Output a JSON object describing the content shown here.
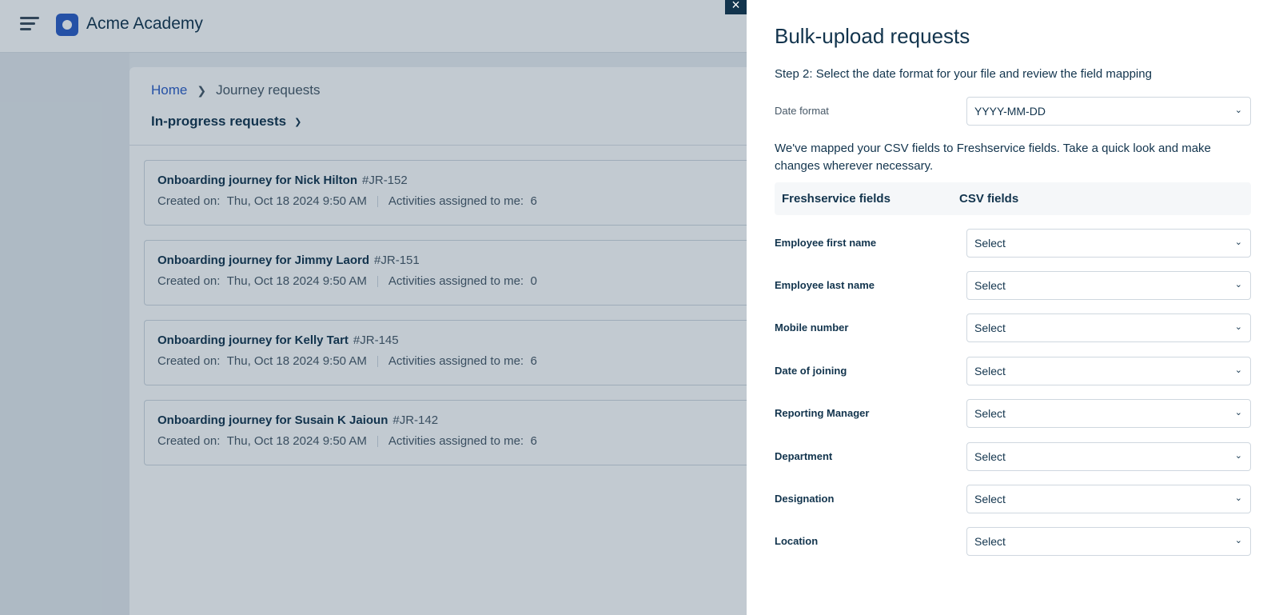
{
  "app": {
    "name": "Acme Academy"
  },
  "breadcrumb": {
    "home": "Home",
    "current": "Journey requests"
  },
  "view": {
    "label": "In-progress requests"
  },
  "requests": [
    {
      "title": "Onboarding journey for Nick Hilton",
      "id": "#JR-152",
      "created_label": "Created on:",
      "created_value": "Thu, Oct 18 2024 9:50 AM",
      "activities_label": "Activities assigned to me:",
      "activities_count": "6"
    },
    {
      "title": "Onboarding journey for Jimmy Laord",
      "id": "#JR-151",
      "created_label": "Created on:",
      "created_value": "Thu, Oct 18 2024 9:50 AM",
      "activities_label": "Activities assigned to me:",
      "activities_count": "0"
    },
    {
      "title": "Onboarding journey for Kelly Tart",
      "id": "#JR-145",
      "created_label": "Created on:",
      "created_value": "Thu, Oct 18 2024 9:50 AM",
      "activities_label": "Activities assigned to me:",
      "activities_count": "6"
    },
    {
      "title": "Onboarding journey for Susain K Jaioun",
      "id": "#JR-142",
      "created_label": "Created on:",
      "created_value": "Thu, Oct 18 2024 9:50 AM",
      "activities_label": "Activities assigned to me:",
      "activities_count": "6"
    }
  ],
  "drawer": {
    "close_icon": "×",
    "title": "Bulk-upload requests",
    "step": "Step 2: Select the date format for your file and review the field mapping",
    "date_format_label": "Date format",
    "date_format_value": "YYYY-MM-DD",
    "mapping_note": "We've mapped your CSV fields to Freshservice fields. Take a quick look and make changes wherever necessary.",
    "col_freshservice": "Freshservice fields",
    "col_csv": "CSV fields",
    "fields": [
      {
        "label": "Employee first name",
        "value": "Select"
      },
      {
        "label": "Employee last name",
        "value": "Select"
      },
      {
        "label": "Mobile number",
        "value": "Select"
      },
      {
        "label": "Date of joining",
        "value": "Select"
      },
      {
        "label": "Reporting Manager",
        "value": "Select"
      },
      {
        "label": "Department",
        "value": "Select"
      },
      {
        "label": "Designation",
        "value": "Select"
      },
      {
        "label": "Location",
        "value": "Select"
      }
    ]
  },
  "colors": {
    "brand": "#2c5cc5",
    "text": "#12344d",
    "overlay": "#12344d"
  }
}
